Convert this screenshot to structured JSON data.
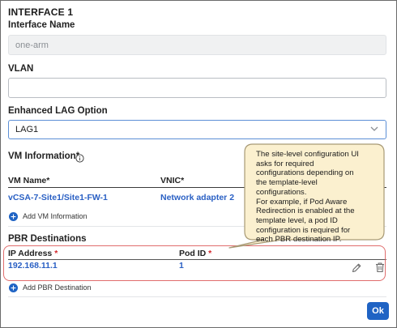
{
  "interface": {
    "title": "INTERFACE 1",
    "name_label": "Interface Name",
    "name_value": "one-arm",
    "vlan_label": "VLAN",
    "vlan_value": "",
    "lag_label": "Enhanced LAG Option",
    "lag_value": "LAG1"
  },
  "vm_info": {
    "label": "VM Information*",
    "icon": "info-icon",
    "headers": {
      "vm_name": "VM Name*",
      "vnic": "VNIC*"
    },
    "rows": [
      {
        "vm_name": "vCSA-7-Site1/Site1-FW-1",
        "vnic": "Network adapter 2"
      }
    ],
    "add_label": "Add VM Information"
  },
  "pbr": {
    "label": "PBR Destinations",
    "headers": {
      "ip": "IP Address",
      "pod": "Pod ID",
      "required_mark": "*"
    },
    "rows": [
      {
        "ip": "192.168.11.1",
        "pod": "1"
      }
    ],
    "add_label": "Add PBR Destination",
    "edit_icon": "pencil-icon",
    "delete_icon": "trash-icon"
  },
  "callout": {
    "lines": [
      "The site-level configuration UI",
      "asks for required",
      "configurations depending on",
      "the template-level",
      "configurations.",
      "For example, if Pod Aware",
      "Redirection is enabled at the",
      "template level, a pod ID",
      "configuration is required for",
      "each PBR destination IP."
    ]
  },
  "footer": {
    "ok_label": "Ok"
  },
  "colors": {
    "accent": "#1f63c4",
    "link": "#2a60c4",
    "required": "#d3262b",
    "callout_fill": "#fbf0cf",
    "callout_border": "#a89a76",
    "highlight": "#e06d6d"
  }
}
